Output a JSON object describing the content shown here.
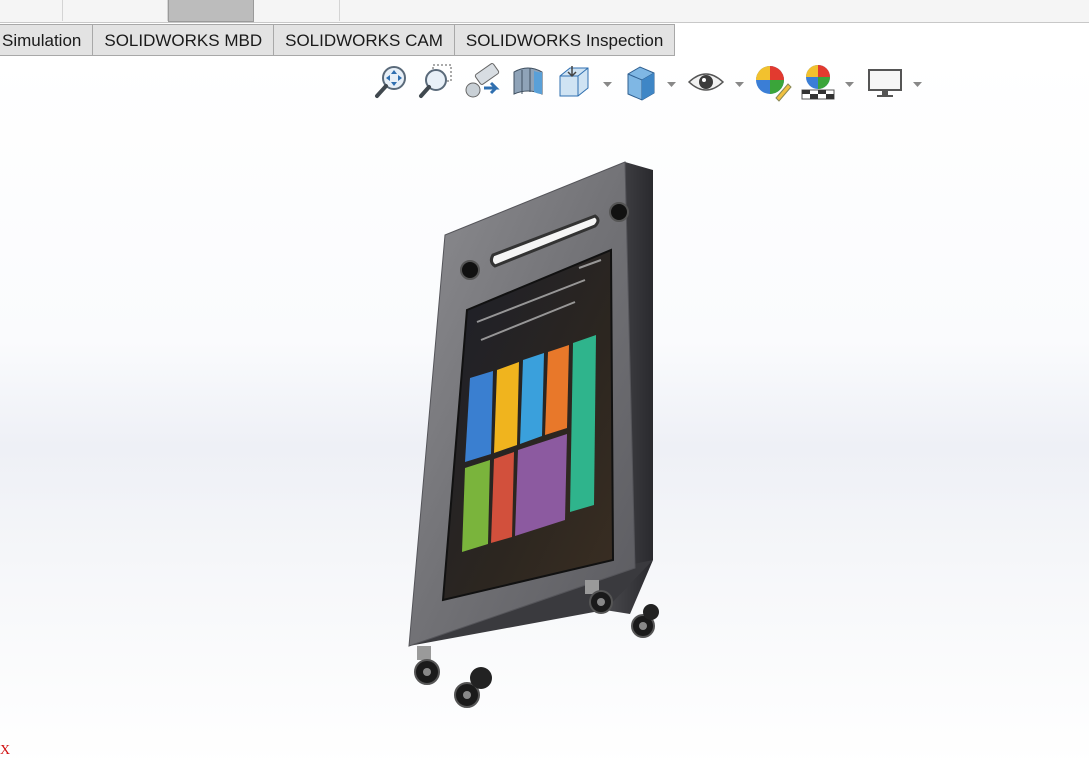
{
  "command_manager": {
    "tabs": [
      {
        "label": "Simulation"
      },
      {
        "label": "SOLIDWORKS MBD"
      },
      {
        "label": "SOLIDWORKS CAM"
      },
      {
        "label": "SOLIDWORKS Inspection"
      }
    ]
  },
  "heads_up_toolbar": {
    "icons": [
      "zoom-to-fit-icon",
      "zoom-to-area-icon",
      "previous-view-icon",
      "section-view-icon",
      "view-orientation-icon",
      "display-style-icon",
      "hide-show-items-icon",
      "edit-appearance-icon",
      "apply-scene-icon",
      "view-settings-icon"
    ]
  },
  "triad": {
    "x_label": "X"
  },
  "colors": {
    "tab_bg": "#e3e3e3",
    "viewport_bg": "#eef0f6",
    "axis_red": "#d01010",
    "tile_colors": [
      "#3a7fd0",
      "#f0b41e",
      "#3aa0dc",
      "#e8782a",
      "#2fb48c",
      "#7ab43c",
      "#d2503c",
      "#8c5aa0"
    ]
  }
}
